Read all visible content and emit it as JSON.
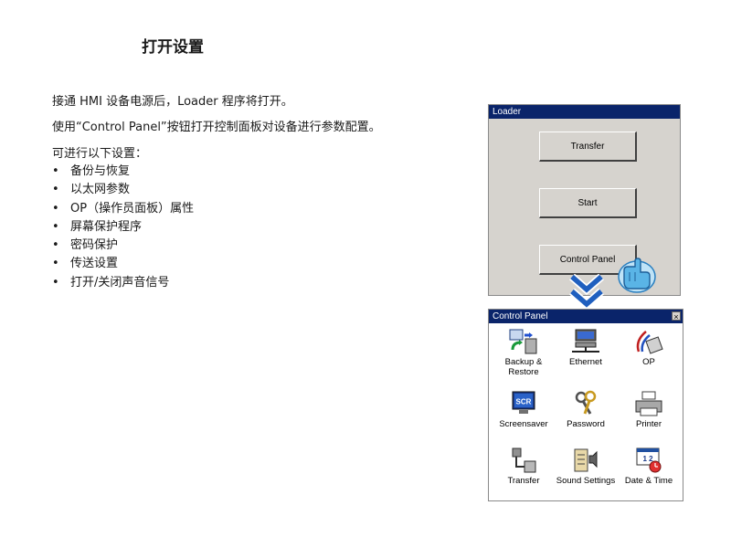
{
  "heading": "打开设置",
  "paragraphs": [
    "接通 HMI 设备电源后，Loader 程序将打开。",
    "使用“Control Panel”按钮打开控制面板对设备进行参数配置。",
    "可进行以下设置："
  ],
  "settings_list": [
    "备份与恢复",
    "以太网参数",
    "OP（操作员面板）属性",
    "屏幕保护程序",
    "密码保护",
    "传送设置",
    "打开/关闭声音信号"
  ],
  "bullet": "•",
  "loader": {
    "title": "Loader",
    "buttons": [
      "Transfer",
      "Start",
      "Control Panel"
    ]
  },
  "control_panel": {
    "title": "Control Panel",
    "close": "×",
    "items": [
      {
        "label": "Backup & Restore",
        "icon": "backup-restore-icon"
      },
      {
        "label": "Ethernet",
        "icon": "ethernet-icon"
      },
      {
        "label": "OP",
        "icon": "op-icon"
      },
      {
        "label": "Screensaver",
        "icon": "screensaver-icon"
      },
      {
        "label": "Password",
        "icon": "password-keys-icon"
      },
      {
        "label": "Printer",
        "icon": "printer-icon"
      },
      {
        "label": "Transfer",
        "icon": "transfer-icon"
      },
      {
        "label": "Sound Settings",
        "icon": "sound-settings-icon"
      },
      {
        "label": "Date & Time",
        "icon": "date-time-icon"
      }
    ],
    "screensaver_icon_text": "SCR",
    "date_icon_text": "1 2"
  },
  "colors": {
    "titlebar": "#0a246a",
    "window_bg": "#d6d3ce",
    "arrow": "#1f5fbf",
    "hand": "#5ab4e6"
  }
}
